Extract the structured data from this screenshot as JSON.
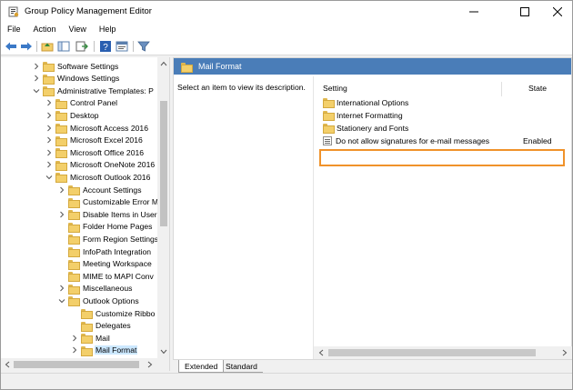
{
  "window": {
    "title": "Group Policy Management Editor",
    "icons": {
      "app": "group-policy-icon",
      "minimize": "minimize-icon",
      "maximize": "maximize-icon",
      "close": "close-icon"
    }
  },
  "menu": [
    "File",
    "Action",
    "View",
    "Help"
  ],
  "toolbar": [
    "back-icon",
    "forward-icon",
    "up-folder-icon",
    "show-hide-tree-icon",
    "export-icon",
    "help-icon",
    "properties-icon",
    "filter-icon"
  ],
  "tree": {
    "items": [
      {
        "label": "Software Settings",
        "expanded": false
      },
      {
        "label": "Windows Settings",
        "expanded": false
      },
      {
        "label": "Administrative Templates: P",
        "expanded": true
      },
      {
        "label": "Control Panel",
        "expanded": false
      },
      {
        "label": "Desktop",
        "expanded": false
      },
      {
        "label": "Microsoft Access 2016",
        "expanded": false
      },
      {
        "label": "Microsoft Excel 2016",
        "expanded": false
      },
      {
        "label": "Microsoft Office 2016",
        "expanded": false
      },
      {
        "label": "Microsoft OneNote 2016",
        "expanded": false
      },
      {
        "label": "Microsoft Outlook 2016",
        "expanded": true
      },
      {
        "label": "Account Settings",
        "expanded": false
      },
      {
        "label": "Customizable Error M",
        "expanded": null
      },
      {
        "label": "Disable Items in User",
        "expanded": false
      },
      {
        "label": "Folder Home Pages",
        "expanded": null
      },
      {
        "label": "Form Region Settings",
        "expanded": null
      },
      {
        "label": "InfoPath Integration",
        "expanded": null
      },
      {
        "label": "Meeting Workspace",
        "expanded": null
      },
      {
        "label": "MIME to MAPI Conv",
        "expanded": null
      },
      {
        "label": "Miscellaneous",
        "expanded": false
      },
      {
        "label": "Outlook Options",
        "expanded": true
      },
      {
        "label": "Customize Ribbo",
        "expanded": null
      },
      {
        "label": "Delegates",
        "expanded": null
      },
      {
        "label": "Mail",
        "expanded": false
      },
      {
        "label": "Mail Format",
        "expanded": false,
        "selected": true
      }
    ]
  },
  "content": {
    "header": "Mail Format",
    "description": "Select an item to view its description.",
    "columns": {
      "setting": "Setting",
      "state": "State"
    },
    "rows": [
      {
        "label": "International Options",
        "state": "",
        "type": "folder"
      },
      {
        "label": "Internet Formatting",
        "state": "",
        "type": "folder"
      },
      {
        "label": "Stationery and Fonts",
        "state": "",
        "type": "folder"
      },
      {
        "label": "Do not allow signatures for e-mail messages",
        "state": "Enabled",
        "type": "setting"
      }
    ],
    "highlight_color": "#f0922a",
    "header_color": "#4a7db8"
  },
  "tabs": [
    "Extended",
    "Standard"
  ]
}
